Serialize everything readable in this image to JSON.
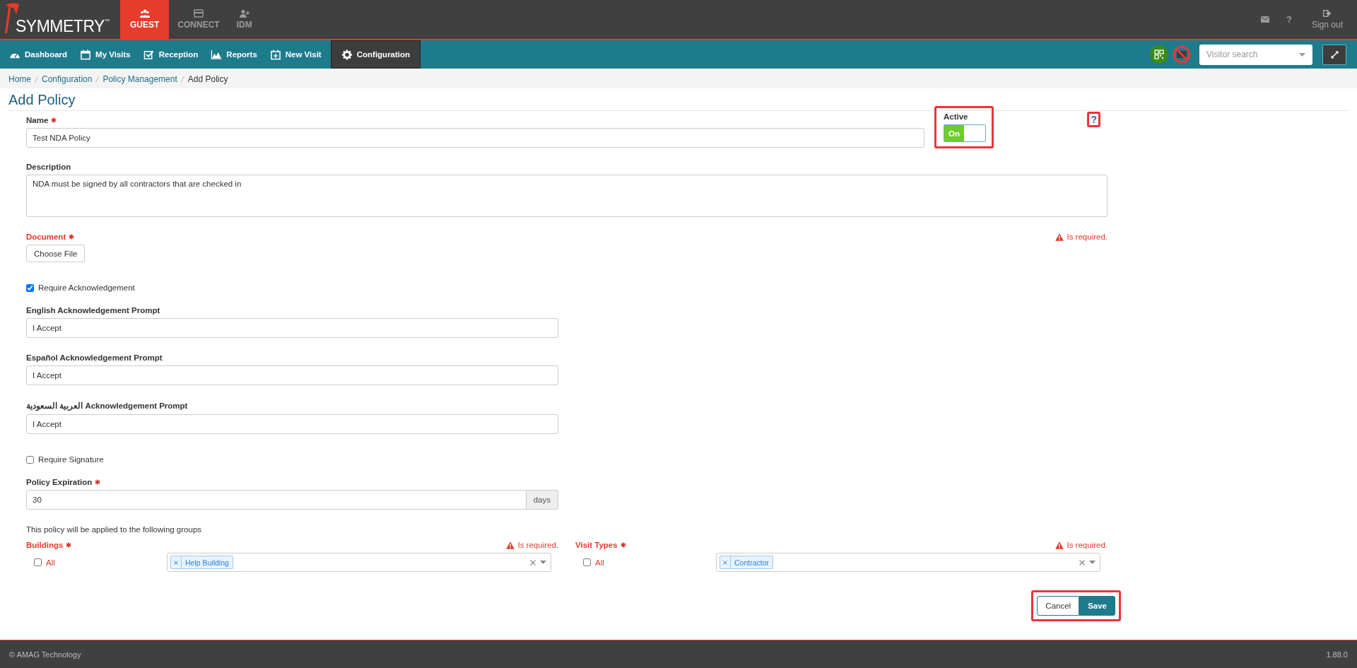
{
  "app": {
    "logo": "SYMMETRY",
    "trademark": "™"
  },
  "modules": [
    {
      "label": "GUEST",
      "selected": true
    },
    {
      "label": "CONNECT",
      "selected": false
    },
    {
      "label": "IDM",
      "selected": false
    }
  ],
  "header_actions": {
    "help": "?",
    "sign_out": "Sign out"
  },
  "nav": [
    {
      "label": "Dashboard",
      "selected": false
    },
    {
      "label": "My Visits",
      "selected": false
    },
    {
      "label": "Reception",
      "selected": false
    },
    {
      "label": "Reports",
      "selected": false
    },
    {
      "label": "New Visit",
      "selected": false
    },
    {
      "label": "Configuration",
      "selected": true
    }
  ],
  "visitor_search": {
    "placeholder": "Visitor search"
  },
  "breadcrumb": [
    {
      "label": "Home",
      "current": false
    },
    {
      "label": "Configuration",
      "current": false
    },
    {
      "label": "Policy Management",
      "current": false
    },
    {
      "label": "Add Policy",
      "current": true
    }
  ],
  "page_title": "Add Policy",
  "form": {
    "name": {
      "label": "Name",
      "required": true,
      "value": "Test NDA Policy"
    },
    "active": {
      "label": "Active",
      "on": true,
      "state_label": "On",
      "highlighted": true
    },
    "help": {
      "label": "?",
      "highlighted": true
    },
    "fields": [
      {
        "kind": "textarea",
        "label": "Description",
        "required": false,
        "value": "NDA must be signed by all contractors that are checked in"
      },
      {
        "kind": "file",
        "label": "Document",
        "required": true,
        "error": "Is required.",
        "button": "Choose File"
      },
      {
        "kind": "checkbox",
        "label": "Require Acknowledgement",
        "checked": true
      },
      {
        "kind": "text",
        "label": "English Acknowledgement Prompt",
        "required": false,
        "value": "I Accept"
      },
      {
        "kind": "text",
        "label": "Español Acknowledgement Prompt",
        "required": false,
        "value": "I Accept"
      },
      {
        "kind": "text",
        "label": "العربية السعودية Acknowledgement Prompt",
        "required": false,
        "value": "I Accept"
      },
      {
        "kind": "checkbox",
        "label": "Require Signature",
        "checked": false
      },
      {
        "kind": "addon",
        "label": "Policy Expiration",
        "required": true,
        "value": "30",
        "addon": "days"
      },
      {
        "kind": "note",
        "text": "This policy will be applied to the following groups"
      }
    ],
    "groups": [
      {
        "label": "Buildings",
        "required": true,
        "error": "Is required.",
        "all_label": "All",
        "all_checked": false,
        "tags": [
          "Help Building"
        ]
      },
      {
        "label": "Visit Types",
        "required": true,
        "error": "Is required.",
        "all_label": "All",
        "all_checked": false,
        "tags": [
          "Contractor"
        ]
      }
    ],
    "buttons": {
      "cancel": "Cancel",
      "save": "Save",
      "highlighted": true
    }
  },
  "footer": {
    "copyright": "© AMAG Technology",
    "version": "1.88.0"
  }
}
